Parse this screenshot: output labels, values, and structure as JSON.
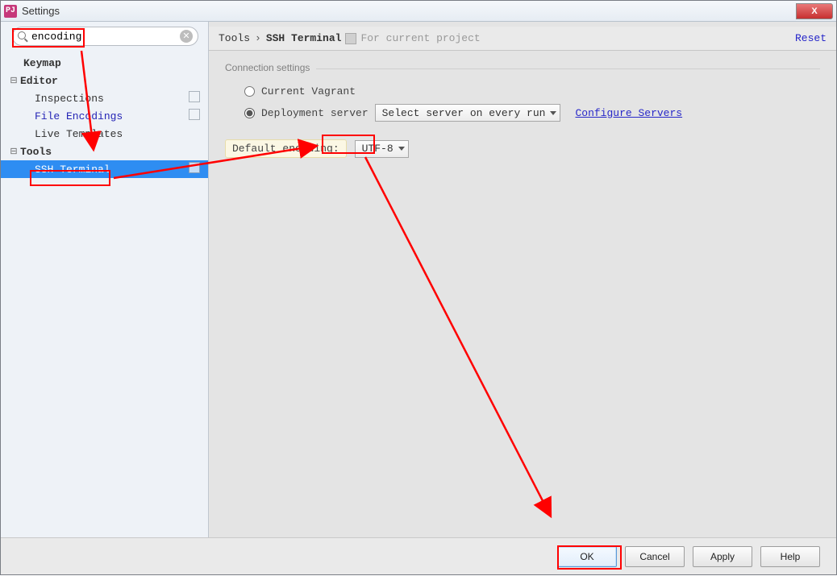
{
  "window": {
    "title": "Settings",
    "app_icon_text": "PJ",
    "close_glyph": "X"
  },
  "search": {
    "value": "encoding"
  },
  "tree": {
    "keymap": "Keymap",
    "editor": "Editor",
    "inspections": "Inspections",
    "file_encodings": "File Encodings",
    "live_templates": "Live Templates",
    "tools": "Tools",
    "ssh_terminal": "SSH Terminal"
  },
  "breadcrumb": {
    "a": "Tools",
    "sep": "›",
    "b": "SSH Terminal",
    "proj_note": "For current project",
    "reset": "Reset"
  },
  "panel": {
    "fieldset_label": "Connection settings",
    "radio_vagrant": "Current Vagrant",
    "radio_deploy": "Deployment server",
    "deploy_select": "Select server on every run",
    "configure": "Configure Servers",
    "enc_label": "Default encoding:",
    "enc_value": "UTF-8"
  },
  "footer": {
    "ok": "OK",
    "cancel": "Cancel",
    "apply": "Apply",
    "help": "Help"
  }
}
